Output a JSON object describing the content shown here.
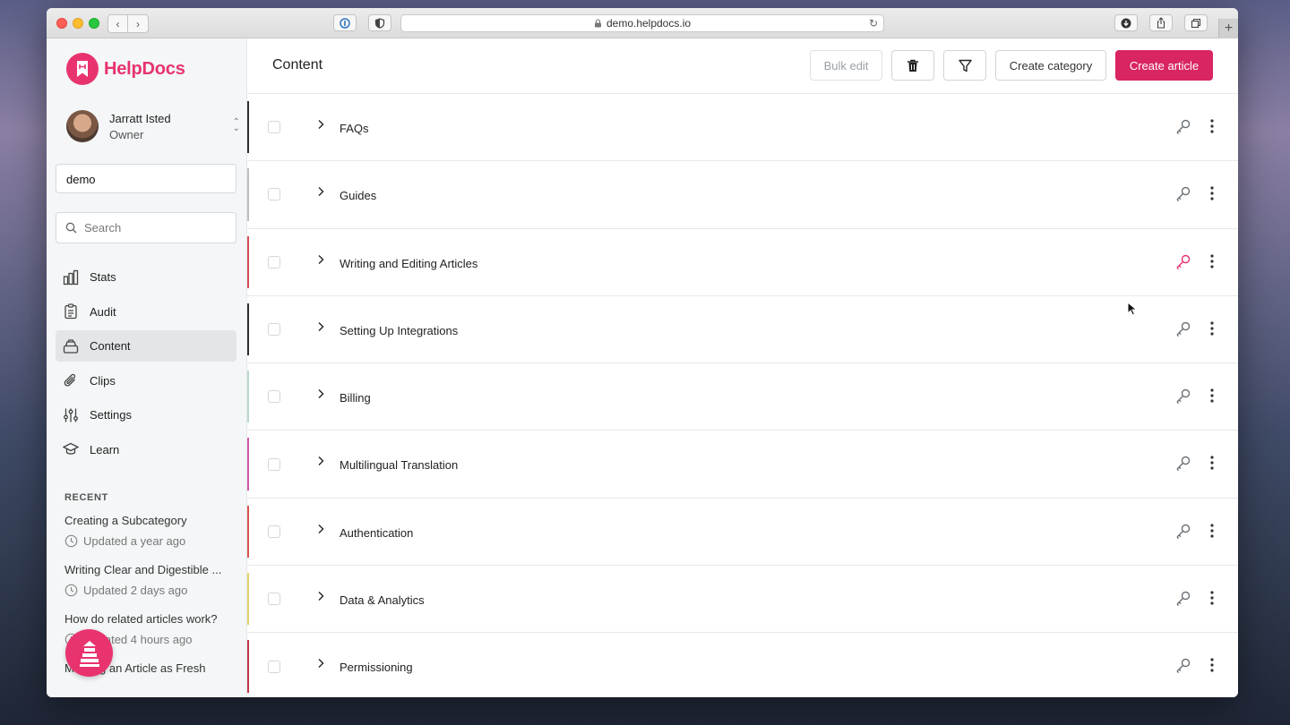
{
  "browser": {
    "url": "demo.helpdocs.io"
  },
  "brand": {
    "name": "HelpDocs",
    "accent": "#e8336f",
    "primary_button": "#d92561"
  },
  "user": {
    "name": "Jarratt Isted",
    "role": "Owner"
  },
  "workspace": "demo",
  "search": {
    "placeholder": "Search"
  },
  "nav": [
    {
      "label": "Stats",
      "icon": "bar-chart-icon"
    },
    {
      "label": "Audit",
      "icon": "clipboard-icon"
    },
    {
      "label": "Content",
      "icon": "stack-icon",
      "active": true
    },
    {
      "label": "Clips",
      "icon": "paperclip-icon"
    },
    {
      "label": "Settings",
      "icon": "sliders-icon"
    },
    {
      "label": "Learn",
      "icon": "graduation-cap-icon"
    }
  ],
  "recent": {
    "title": "RECENT",
    "items": [
      {
        "name": "Creating a Subcategory",
        "time": "Updated a year ago"
      },
      {
        "name": "Writing Clear and Digestible ...",
        "time": "Updated 2 days ago"
      },
      {
        "name": "How do related articles work?",
        "time": "Updated 4 hours ago"
      },
      {
        "name": "Marking an Article as Fresh",
        "time": ""
      }
    ]
  },
  "header": {
    "title": "Content",
    "bulk_edit": "Bulk edit",
    "create_category": "Create category",
    "create_article": "Create article"
  },
  "categories": [
    {
      "label": "FAQs",
      "color": "#2b2f33",
      "key_color": "#6b7075"
    },
    {
      "label": "Guides",
      "color": "#b9bec3",
      "key_color": "#6b7075"
    },
    {
      "label": "Writing and Editing Articles",
      "color": "#d94b5c",
      "key_color": "#e8336f"
    },
    {
      "label": "Setting Up Integrations",
      "color": "#2b2f33",
      "key_color": "#6b7075"
    },
    {
      "label": "Billing",
      "color": "#b9d8c8",
      "key_color": "#6b7075"
    },
    {
      "label": "Multilingual Translation",
      "color": "#d05aa8",
      "key_color": "#6b7075"
    },
    {
      "label": "Authentication",
      "color": "#d9534f",
      "key_color": "#6b7075"
    },
    {
      "label": "Data & Analytics",
      "color": "#e0d36a",
      "key_color": "#6b7075"
    },
    {
      "label": "Permissioning",
      "color": "#c0354a",
      "key_color": "#6b7075"
    }
  ]
}
